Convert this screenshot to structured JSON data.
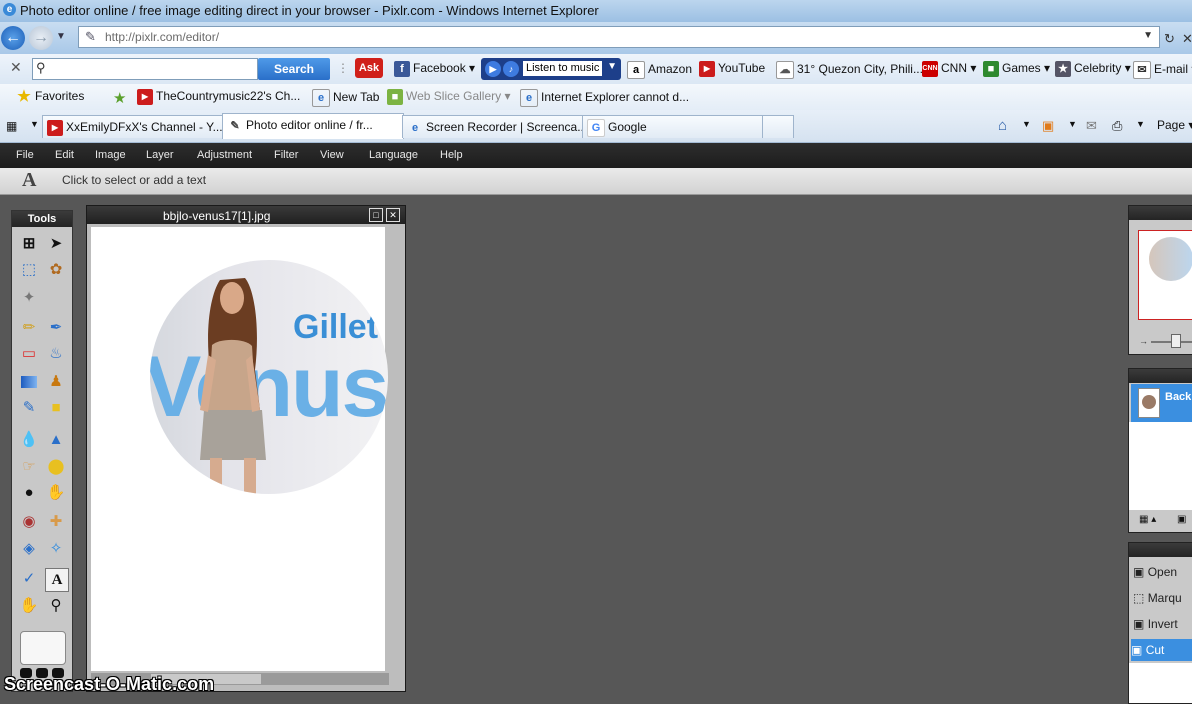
{
  "window": {
    "title": "Photo editor online / free image editing direct in your browser - Pixlr.com - Windows Internet Explorer"
  },
  "nav": {
    "url": "http://pixlr.com/editor/"
  },
  "toolbar": {
    "search_label": "Search",
    "listen_label": "Listen to music",
    "items": [
      "Facebook",
      "Amazon",
      "YouTube",
      "31° Quezon City, Phili...",
      "CNN",
      "Games",
      "Celebrity",
      "E-mail"
    ]
  },
  "favorites": {
    "label": "Favorites",
    "items": [
      "TheCountrymusic22's Ch...",
      "New Tab",
      "Web Slice Gallery",
      "Internet Explorer cannot d..."
    ]
  },
  "tabs": [
    {
      "label": "XxEmilyDFxX's Channel - Y..."
    },
    {
      "label": "Photo editor online / fr..."
    },
    {
      "label": "Screen Recorder | Screenca..."
    },
    {
      "label": "Google"
    }
  ],
  "tabbar_right": {
    "page_label": "Page"
  },
  "app": {
    "menu": [
      "File",
      "Edit",
      "Image",
      "Layer",
      "Adjustment",
      "Filter",
      "View",
      "Language",
      "Help"
    ],
    "option_hint": "Click to select or add a text",
    "tools_title": "Tools",
    "document_title": "bbjlo-venus17[1].jpg",
    "photo_text": {
      "brand": "Gillette",
      "product": "Venus"
    },
    "layers": {
      "layer_name": "Back"
    },
    "history": [
      "Open",
      "Marqu",
      "Invert",
      "Cut"
    ]
  },
  "watermark": "Screencast-O-Matic.com"
}
